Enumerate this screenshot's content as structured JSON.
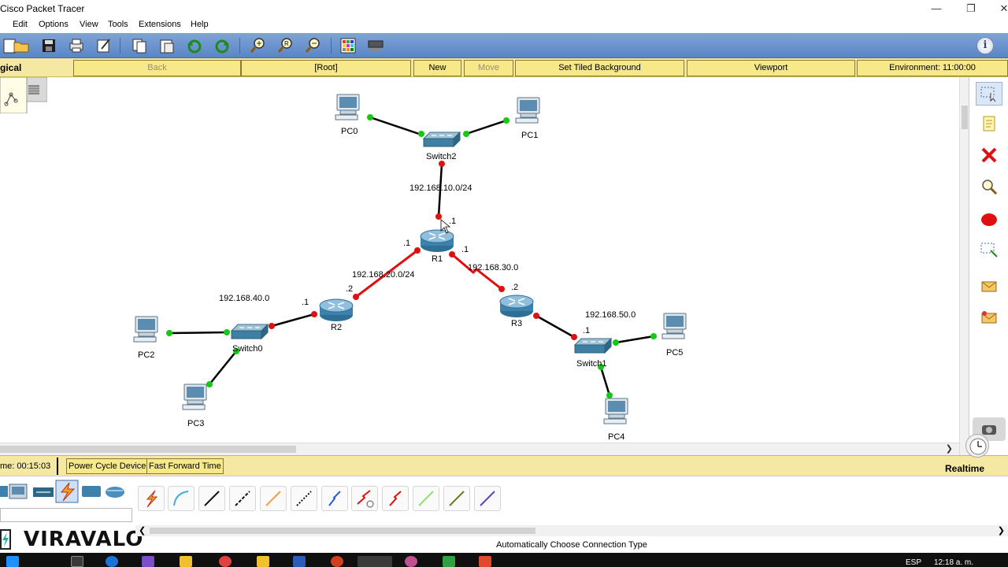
{
  "window": {
    "title": "Cisco Packet Tracer"
  },
  "menu": [
    "Edit",
    "Options",
    "View",
    "Tools",
    "Extensions",
    "Help"
  ],
  "toolbar": {
    "icons": [
      "open-icon",
      "save-icon",
      "print-icon",
      "activity-wizard-icon",
      "copy-icon",
      "paste-icon",
      "undo-icon",
      "redo-icon",
      "zoom-in-icon",
      "zoom-reset-icon",
      "zoom-out-icon",
      "palette-icon",
      "custom-device-icon",
      "info-icon"
    ]
  },
  "logical_bar": {
    "label": "gical",
    "back": "Back",
    "root": "[Root]",
    "new_cluster": "New Cluster",
    "move_object": "Move Object",
    "tiled_background": "Set Tiled Background",
    "viewport": "Viewport",
    "environment": "Environment: 11:00:00"
  },
  "network": {
    "devices": {
      "PC0": "PC0",
      "PC1": "PC1",
      "Switch2": "Switch2",
      "R1": "R1",
      "R2": "R2",
      "R3": "R3",
      "Switch0": "Switch0",
      "Switch1": "Switch1",
      "PC2": "PC2",
      "PC3": "PC3",
      "PC4": "PC4",
      "PC5": "PC5"
    },
    "networks": {
      "net10": "192.168.10.0/24",
      "net20": "192.168.20.0/24",
      "net30": "192.168.30.0",
      "net40": "192.168.40.0",
      "net50": "192.168.50.0"
    },
    "iface_labels": {
      "r1_top": ".1",
      "r1_left": ".1",
      "r1_right": ".1",
      "r2_right": ".2",
      "r2_left": ".1",
      "r3_left": ".2",
      "r3_right": ".1"
    },
    "colors": {
      "link_up": "#14c814",
      "link_down": "#e01010",
      "serial": "#e01010",
      "ethernet": "#000000"
    }
  },
  "palette": [
    "select-icon",
    "note-icon",
    "delete-icon",
    "inspect-icon",
    "draw-ellipse-icon",
    "resize-icon",
    "simple-pdu-icon",
    "complex-pdu-icon"
  ],
  "time_bar": {
    "time": "me: 00:15:03",
    "power_cycle": "Power Cycle Devices",
    "fast_forward": "Fast Forward Time",
    "mode": "Realtime"
  },
  "device_panel": {
    "logo": "VIRAVALO",
    "status": "Automatically Choose Connection Type"
  },
  "taskbar": {
    "lang": "ESP",
    "time": "12:18 a. m."
  }
}
